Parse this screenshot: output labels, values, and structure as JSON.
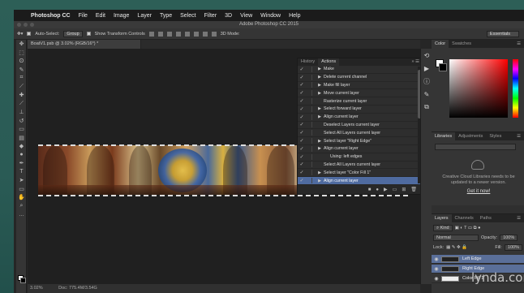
{
  "menubar": {
    "app": "Photoshop CC",
    "items": [
      "File",
      "Edit",
      "Image",
      "Layer",
      "Type",
      "Select",
      "Filter",
      "3D",
      "View",
      "Window",
      "Help"
    ]
  },
  "title": "Adobe Photoshop CC 2015",
  "options": {
    "auto_select": "Auto-Select:",
    "group": "Group",
    "transform": "Show Transform Controls",
    "mode_3d": "3D Mode:",
    "workspace": "Essentials"
  },
  "doc_tab": "BoatV1.psb @ 3.02% (RGB/16*) *",
  "status": {
    "zoom": "3.02%",
    "doc": "Doc: 775.4M/3.54G"
  },
  "actions_panel": {
    "tab_history": "History",
    "tab_actions": "Actions",
    "rows": [
      {
        "label": "Make",
        "check": true,
        "triangle": true,
        "indent": false,
        "selected": false
      },
      {
        "label": "Delete current channel",
        "check": true,
        "triangle": true,
        "indent": false,
        "selected": false
      },
      {
        "label": "Make fill layer",
        "check": true,
        "triangle": true,
        "indent": false,
        "selected": false
      },
      {
        "label": "Move current layer",
        "check": true,
        "triangle": true,
        "indent": false,
        "selected": false
      },
      {
        "label": "Rasterize current layer",
        "check": true,
        "triangle": false,
        "indent": false,
        "selected": false
      },
      {
        "label": "Select forward layer",
        "check": true,
        "triangle": true,
        "indent": false,
        "selected": false
      },
      {
        "label": "Align current layer",
        "check": true,
        "triangle": true,
        "indent": false,
        "selected": false
      },
      {
        "label": "Deselect Layers current layer",
        "check": true,
        "triangle": false,
        "indent": false,
        "selected": false
      },
      {
        "label": "Select All Layers current layer",
        "check": true,
        "triangle": false,
        "indent": false,
        "selected": false
      },
      {
        "label": "Select layer \"Right Edge\"",
        "check": true,
        "triangle": true,
        "indent": false,
        "selected": false
      },
      {
        "label": "Align current layer",
        "check": true,
        "triangle": true,
        "indent": false,
        "selected": false
      },
      {
        "label": "Using: left edges",
        "check": true,
        "triangle": false,
        "indent": true,
        "selected": false
      },
      {
        "label": "Select All Layers current layer",
        "check": true,
        "triangle": false,
        "indent": false,
        "selected": false
      },
      {
        "label": "Select layer \"Color Fill 1\"",
        "check": true,
        "triangle": true,
        "indent": false,
        "selected": false
      },
      {
        "label": "Align current layer",
        "check": true,
        "triangle": true,
        "indent": false,
        "selected": true
      }
    ]
  },
  "color_panel": {
    "tab_color": "Color",
    "tab_swatches": "Swatches"
  },
  "libraries_panel": {
    "tab_libraries": "Libraries",
    "tab_adjustments": "Adjustments",
    "tab_styles": "Styles",
    "message": "Creative Cloud Libraries needs to be updated to a newer version.",
    "button": "Get it now!"
  },
  "layers_panel": {
    "tab_layers": "Layers",
    "tab_channels": "Channels",
    "tab_paths": "Paths",
    "kind": "Kind",
    "blend": "Normal",
    "opacity_label": "Opacity:",
    "opacity": "100%",
    "lock_label": "Lock:",
    "fill_label": "Fill:",
    "fill": "100%",
    "layers": [
      {
        "name": "Left Edge",
        "selected": true
      },
      {
        "name": "Right Edge",
        "selected": true
      },
      {
        "name": "Color Fill 1",
        "selected": false
      }
    ]
  },
  "watermark": "lynda.com"
}
